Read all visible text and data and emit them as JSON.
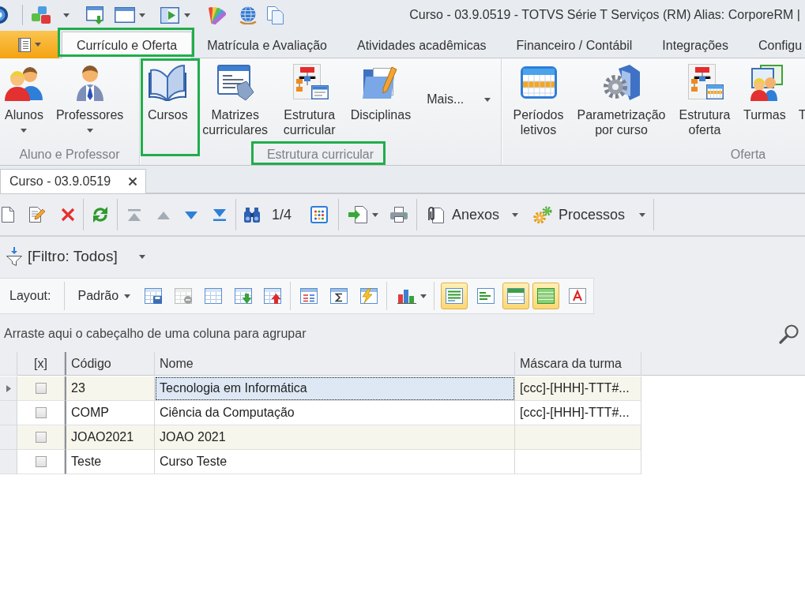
{
  "window": {
    "title": "Curso - 03.9.0519 - TOTVS Série T Serviços (RM) Alias: CorporeRM |"
  },
  "ribbon_tabs": [
    {
      "label": "Currículo e Oferta",
      "selected": true,
      "highlighted": true
    },
    {
      "label": "Matrícula e Avaliação",
      "selected": false,
      "highlighted": false
    },
    {
      "label": "Atividades acadêmicas",
      "selected": false,
      "highlighted": false
    },
    {
      "label": "Financeiro / Contábil",
      "selected": false,
      "highlighted": false
    },
    {
      "label": "Integrações",
      "selected": false,
      "highlighted": false
    },
    {
      "label": "Configu",
      "selected": false,
      "highlighted": false
    }
  ],
  "ribbon_groups": [
    {
      "label": "Aluno e Professor",
      "highlighted": false,
      "buttons": [
        {
          "label": "Alunos",
          "kind": "dropdown",
          "highlighted": false
        },
        {
          "label": "Professores",
          "kind": "dropdown",
          "highlighted": false
        }
      ]
    },
    {
      "label": "Estrutura curricular",
      "highlighted": true,
      "buttons": [
        {
          "label": "Cursos",
          "kind": "large",
          "highlighted": true
        },
        {
          "label": "Matrizes curriculares",
          "kind": "large",
          "highlighted": false
        },
        {
          "label": "Estrutura curricular",
          "kind": "large",
          "highlighted": false
        },
        {
          "label": "Disciplinas",
          "kind": "large",
          "highlighted": false
        },
        {
          "label": "Mais...",
          "kind": "menu",
          "highlighted": false
        }
      ]
    },
    {
      "label": "Oferta",
      "highlighted": false,
      "buttons": [
        {
          "label": "Períodos letivos",
          "kind": "large",
          "highlighted": false
        },
        {
          "label": "Parametrização por curso",
          "kind": "large",
          "highlighted": false
        },
        {
          "label": "Estrutura oferta",
          "kind": "large",
          "highlighted": false
        },
        {
          "label": "Turmas",
          "kind": "large",
          "highlighted": false
        },
        {
          "label": "T",
          "kind": "large",
          "highlighted": false
        }
      ]
    }
  ],
  "document_tabs": [
    {
      "label": "Curso - 03.9.0519",
      "selected": true
    }
  ],
  "toolbar": {
    "navigation": [
      {
        "disabled": true
      },
      {
        "disabled": true
      },
      {
        "disabled": false
      },
      {
        "disabled": false
      }
    ],
    "record_position": "1/4",
    "menus": [
      {
        "label": "Anexos"
      },
      {
        "label": "Processos"
      }
    ]
  },
  "filter": {
    "label": "[Filtro: Todos]"
  },
  "layout_toolbar": {
    "label": "Layout:",
    "layout": "Padrão",
    "layout_actions": [
      {
        "disabled": false
      },
      {
        "disabled": true
      },
      {
        "disabled": false
      },
      {
        "disabled": false
      },
      {
        "disabled": false
      }
    ],
    "view_toggles": [
      {
        "on": true
      },
      {
        "on": false
      },
      {
        "on": true
      },
      {
        "on": true
      },
      {
        "on": false
      }
    ]
  },
  "grid": {
    "group_panel": "Arraste aqui o cabeçalho de uma coluna para agrupar",
    "columns": [
      "[x]",
      "Código",
      "Nome",
      "Máscara da turma"
    ],
    "rows": [
      {
        "current": true,
        "cells": [
          {
            "kind": "checkbox",
            "checked": false,
            "focused": false
          },
          {
            "kind": "text",
            "text": "23",
            "focused": false
          },
          {
            "kind": "text",
            "text": "Tecnologia em Informática",
            "focused": true
          },
          {
            "kind": "text",
            "text": "[ccc]-[HHH]-TTT#...",
            "focused": false
          }
        ]
      },
      {
        "current": false,
        "cells": [
          {
            "kind": "checkbox",
            "checked": false,
            "focused": false
          },
          {
            "kind": "text",
            "text": "COMP",
            "focused": false
          },
          {
            "kind": "text",
            "text": "Ciência da Computação",
            "focused": false
          },
          {
            "kind": "text",
            "text": "[ccc]-[HHH]-TTT#...",
            "focused": false
          }
        ]
      },
      {
        "current": false,
        "cells": [
          {
            "kind": "checkbox",
            "checked": false,
            "focused": false
          },
          {
            "kind": "text",
            "text": "JOAO2021",
            "focused": false
          },
          {
            "kind": "text",
            "text": "JOAO 2021",
            "focused": false
          },
          {
            "kind": "text",
            "focused": false
          }
        ]
      },
      {
        "current": false,
        "cells": [
          {
            "kind": "checkbox",
            "checked": false,
            "focused": false
          },
          {
            "kind": "text",
            "text": "Teste",
            "focused": false
          },
          {
            "kind": "text",
            "text": "Curso Teste",
            "focused": false
          },
          {
            "kind": "text",
            "focused": false
          }
        ]
      }
    ]
  }
}
